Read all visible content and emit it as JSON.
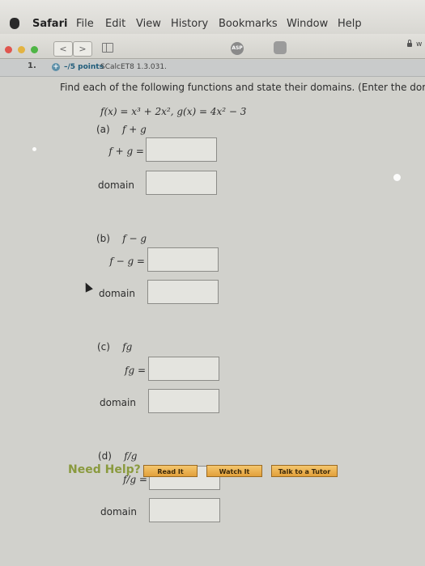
{
  "menubar": {
    "items": [
      "Safari",
      "File",
      "Edit",
      "View",
      "History",
      "Bookmarks",
      "Window",
      "Help"
    ]
  },
  "toolbar": {
    "back_label": "<",
    "forward_label": ">",
    "url_fragment": "w"
  },
  "extensions": {
    "asp_label": "ASP"
  },
  "question": {
    "number": "1.",
    "points": "–/5 points",
    "source": "SCalcET8 1.3.031.",
    "instructions": "Find each of the following functions and state their domains. (Enter the doma",
    "functions": "f(x) = x³ + 2x²,  g(x) = 4x² − 3"
  },
  "parts": [
    {
      "label": "(a)",
      "expression": "f + g",
      "answer_label": "f + g =",
      "domain_label": "domain"
    },
    {
      "label": "(b)",
      "expression": "f − g",
      "answer_label": "f − g =",
      "domain_label": "domain"
    },
    {
      "label": "(c)",
      "expression": "fg",
      "answer_label": "fg =",
      "domain_label": "domain"
    },
    {
      "label": "(d)",
      "expression": "f/g",
      "answer_label": "f/g =",
      "domain_label": "domain"
    }
  ],
  "help": {
    "title": "Need Help?",
    "read_label": "Read It",
    "watch_label": "Watch It",
    "tutor_label": "Talk to a Tutor"
  },
  "colors": {
    "accent": "#1f5b7a",
    "help_green": "#8a9a3e",
    "button_orange": "#e2a03a"
  }
}
